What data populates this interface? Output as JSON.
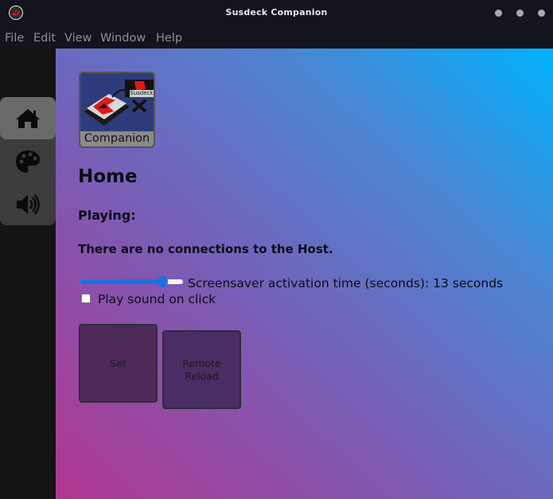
{
  "window": {
    "title": "Susdeck Companion"
  },
  "menu": [
    "File",
    "Edit",
    "View",
    "Window",
    "Help"
  ],
  "sidebar": [
    {
      "name": "home",
      "icon": "home-icon",
      "active": true
    },
    {
      "name": "themes",
      "icon": "palette-icon",
      "active": false
    },
    {
      "name": "sound",
      "icon": "speaker-icon",
      "active": false
    }
  ],
  "logo": {
    "caption": "Companion",
    "badge": "Susdeck"
  },
  "page": {
    "title": "Home",
    "playing_label": "Playing:",
    "connection_status": "There are no connections to the Host."
  },
  "screensaver": {
    "label": "Screensaver activation time (seconds): 13 seconds",
    "slider_fraction": 0.8
  },
  "sound_on_click": {
    "label": "Play sound on click",
    "checked": false
  },
  "buttons": {
    "set": "Set",
    "remote_reload": "Remote Reload"
  },
  "colors": {
    "titlebar": "#14141c",
    "sidebar": "#141414",
    "slider": "#1f6fe0",
    "gradient_start": "#b23690",
    "gradient_end": "#00b2fc"
  }
}
